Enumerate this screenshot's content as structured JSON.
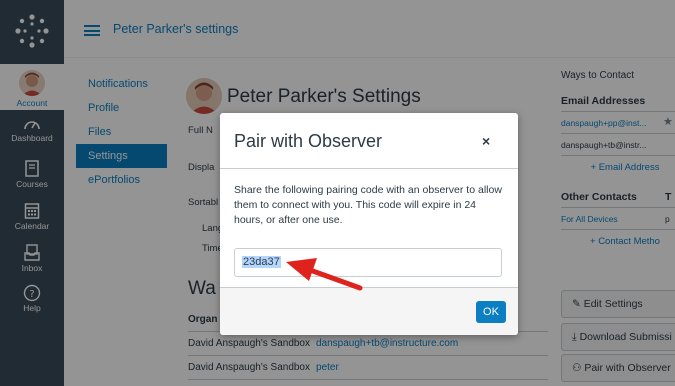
{
  "breadcrumb": "Peter Parker's settings",
  "global_nav": [
    {
      "label": "Account",
      "icon": "avatar"
    },
    {
      "label": "Dashboard",
      "icon": "dashboard-icon"
    },
    {
      "label": "Courses",
      "icon": "courses-icon"
    },
    {
      "label": "Calendar",
      "icon": "calendar-icon"
    },
    {
      "label": "Inbox",
      "icon": "inbox-icon"
    },
    {
      "label": "Help",
      "icon": "help-icon"
    }
  ],
  "left_nav": [
    "Notifications",
    "Profile",
    "Files",
    "Settings",
    "ePortfolios"
  ],
  "main": {
    "title": "Peter Parker's Settings",
    "field_labels": [
      "Full N",
      "Displa",
      "Sortabl",
      "Lang",
      "Time"
    ],
    "ways_heading": "Wa",
    "table_header": "Organ",
    "rows": [
      {
        "org": "David Anspaugh's Sandbox",
        "value": "danspaugh+tb@instructure.com"
      },
      {
        "org": "David Anspaugh's Sandbox",
        "value": "peter"
      }
    ]
  },
  "right": {
    "heading": "Ways to Contact",
    "email_heading": "Email Addresses",
    "emails": [
      "danspaugh+pp@inst...",
      "danspaugh+tb@instr..."
    ],
    "add_email": "Email Address",
    "other_heading": "Other Contacts",
    "other_col": "T",
    "for_all_devices": "For All Devices",
    "for_all_devices_col": "p",
    "add_contact": "Contact Metho",
    "buttons": [
      "Edit Settings",
      "Download Submissi",
      "Pair with Observer"
    ]
  },
  "modal": {
    "title": "Pair with Observer",
    "close": "×",
    "body": "Share the following pairing code with an observer to allow them to connect with you. This code will expire in 24 hours, or after one use.",
    "code": "23da37",
    "ok": "OK"
  },
  "colors": {
    "nav_bg": "#394b58",
    "brand": "#0b7fc2",
    "arrow": "#e0221c"
  }
}
